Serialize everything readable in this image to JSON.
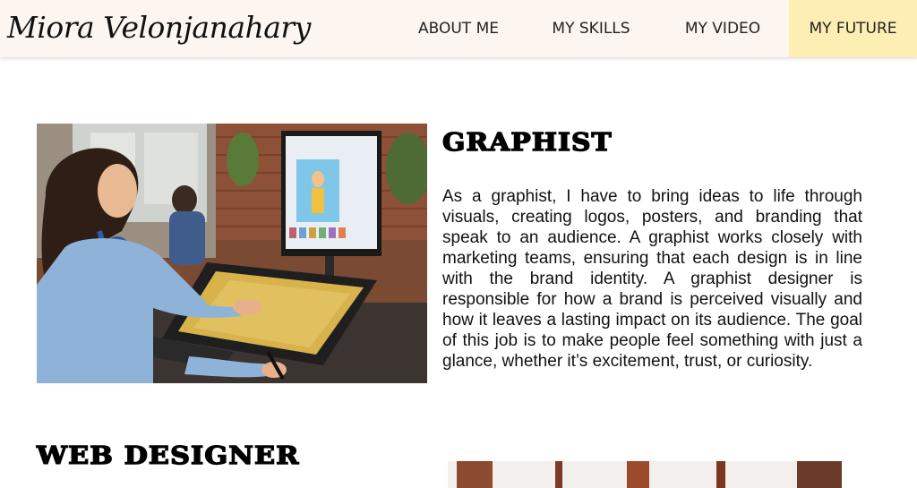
{
  "header": {
    "logo_text": "Miora Velonjanahary",
    "nav": [
      {
        "label": "ABOUT ME"
      },
      {
        "label": "MY SKILLS"
      },
      {
        "label": "MY VIDEO"
      },
      {
        "label": "MY FUTURE",
        "active": true
      }
    ]
  },
  "sections": [
    {
      "heading": "GRAPHIST",
      "paragraph": "As a graphist, I have to bring ideas to life through visuals, creating logos, posters, and branding that speak to an audience. A graphist works closely with marketing teams, ensuring that each design is in line with the brand identity. A graphist designer is responsible for how a brand is perceived visually and how it leaves a lasting impact on its audience. The goal of this job is to make people feel something with just a glance, whether it’s excitement, trust, or curiosity."
    },
    {
      "heading": "WEB DESIGNER"
    }
  ],
  "colors": {
    "nav_background": "#fdf6f0",
    "nav_active_background": "#fdeeb4"
  }
}
